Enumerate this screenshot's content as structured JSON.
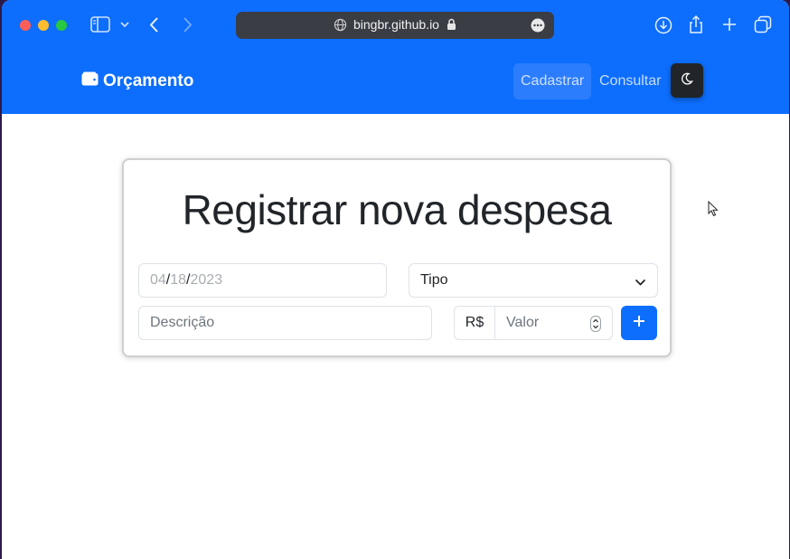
{
  "browser": {
    "url": "bingbr.github.io",
    "icons": [
      "sidebar-icon",
      "chevron-down-icon",
      "back-icon",
      "forward-icon",
      "globe-icon",
      "lock-icon",
      "more-icon",
      "download-icon",
      "share-icon",
      "new-tab-icon",
      "tabs-icon"
    ]
  },
  "navbar": {
    "brand": "Orçamento",
    "links": [
      "Cadastrar",
      "Consultar"
    ],
    "active_link": "Cadastrar",
    "theme_icon": "moon-icon",
    "color": "#0d6efd"
  },
  "form": {
    "title": "Registrar nova despesa",
    "date": {
      "month": "04",
      "day": "18",
      "year": "2023",
      "separator": "/"
    },
    "tipo_label": "Tipo",
    "descricao_placeholder": "Descrição",
    "currency_prefix": "R$",
    "valor_placeholder": "Valor",
    "submit_icon": "plus-icon"
  }
}
